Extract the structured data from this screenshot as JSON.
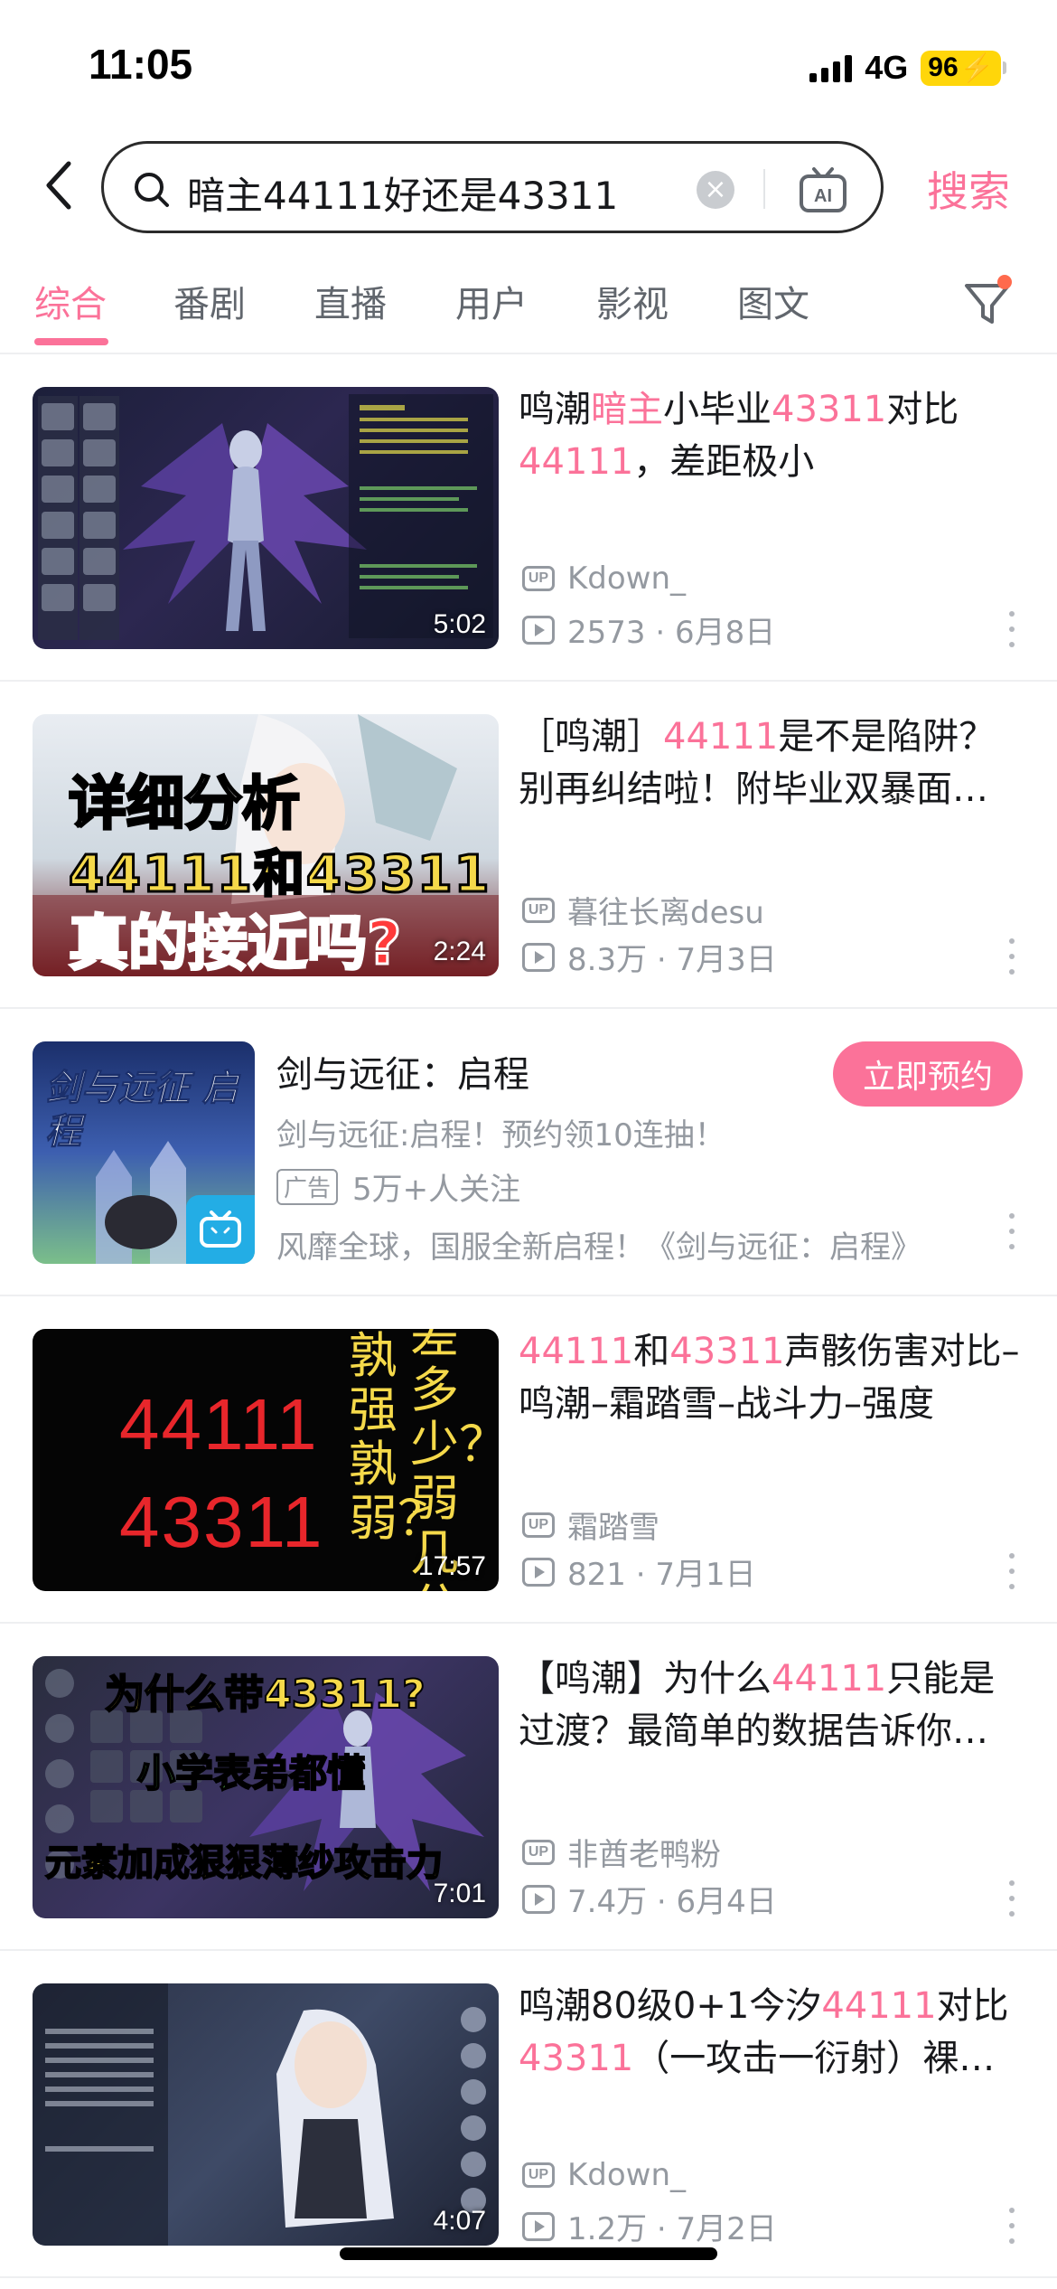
{
  "status_bar": {
    "time": "11:05",
    "network": "4G",
    "battery": "96"
  },
  "search": {
    "query": "暗主44111好还是43311",
    "submit_label": "搜索",
    "ai_label": "AI"
  },
  "tabs": [
    {
      "label": "综合",
      "active": true
    },
    {
      "label": "番剧"
    },
    {
      "label": "直播"
    },
    {
      "label": "用户"
    },
    {
      "label": "影视"
    },
    {
      "label": "图文"
    }
  ],
  "results": [
    {
      "title_parts": [
        {
          "text": "鸣潮"
        },
        {
          "text": "暗主",
          "highlight": true
        },
        {
          "text": "小毕业"
        },
        {
          "text": "43311",
          "highlight": true
        },
        {
          "text": "对比"
        },
        {
          "text": "44111",
          "highlight": true
        },
        {
          "text": "，差距极小"
        }
      ],
      "duration": "5:02",
      "author": "Kdown_",
      "stats": "2573 · 6月8日"
    },
    {
      "title_parts": [
        {
          "text": "［鸣潮］"
        },
        {
          "text": "44111",
          "highlight": true
        },
        {
          "text": "是不是陷阱？别再纠结啦！附毕业双暴面…"
        }
      ],
      "duration": "2:24",
      "thumb_text": {
        "line1": "详细分析",
        "line2": "44111和43311",
        "line3": "真的接近吗?"
      },
      "author": "暮往长离desu",
      "stats": "8.3万 · 7月3日"
    },
    {
      "title_parts": [
        {
          "text": "44111",
          "highlight": true
        },
        {
          "text": "和"
        },
        {
          "text": "43311",
          "highlight": true
        },
        {
          "text": "声骸伤害对比–鸣潮–霜踏雪–战斗力–强度"
        }
      ],
      "duration": "17:57",
      "thumb_text": {
        "num1": "44111",
        "num2": "43311",
        "vert1": "孰强孰弱？",
        "vert2": "差多少？弱几分"
      },
      "author": "霜踏雪",
      "stats": "821 · 7月1日"
    },
    {
      "title_parts": [
        {
          "text": "【鸣潮】为什么"
        },
        {
          "text": "44111",
          "highlight": true
        },
        {
          "text": "只能是过渡？最简单的数据告诉你…"
        }
      ],
      "duration": "7:01",
      "thumb_text": {
        "line1": "为什么带43311?",
        "line2": "小学表弟都懂",
        "line3": "元素加成狠狠薄纱攻击力"
      },
      "author": "非酋老鸭粉",
      "stats": "7.4万 · 6月4日"
    },
    {
      "title_parts": [
        {
          "text": "鸣潮80级0+1今汐"
        },
        {
          "text": "44111",
          "highlight": true
        },
        {
          "text": "对比"
        },
        {
          "text": "43311",
          "highlight": true
        },
        {
          "text": "（一攻击一衍射）裸…"
        }
      ],
      "duration": "4:07",
      "author": "Kdown_",
      "stats": "1.2万 · 7月2日"
    }
  ],
  "ad": {
    "title": "剑与远征：启程",
    "subtitle": "剑与远征:启程！预约领10连抽！",
    "badge": "广告",
    "followers": "5万+人关注",
    "description": "风靡全球，国服全新启程！《剑与远征：启程》",
    "cta": "立即预约",
    "logo_text": "剑与远征 启程"
  },
  "colors": {
    "accent": "#fb7299",
    "text_primary": "#18191c",
    "text_secondary": "#9499a0"
  }
}
